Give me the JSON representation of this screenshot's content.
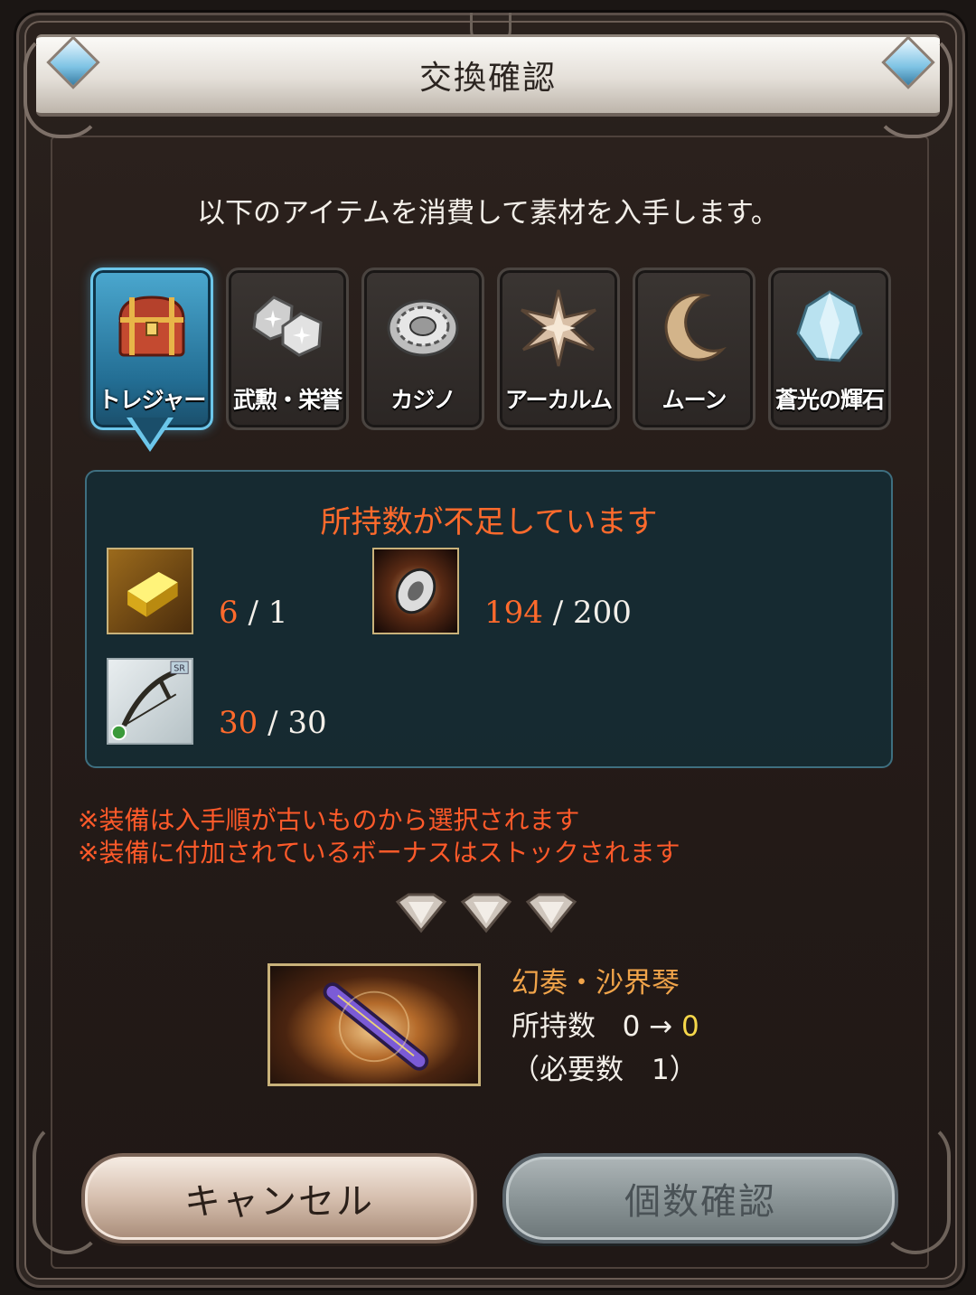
{
  "dialog": {
    "title": "交換確認",
    "subtitle": "以下のアイテムを消費して素材を入手します。"
  },
  "tabs": [
    {
      "label": "トレジャー",
      "icon": "treasure-chest-icon",
      "selected": true
    },
    {
      "label": "武勲・栄誉",
      "icon": "honor-badges-icon",
      "selected": false
    },
    {
      "label": "カジノ",
      "icon": "casino-chip-icon",
      "selected": false
    },
    {
      "label": "アーカルム",
      "icon": "arcarum-star-icon",
      "selected": false
    },
    {
      "label": "ムーン",
      "icon": "moon-icon",
      "selected": false
    },
    {
      "label": "蒼光の輝石",
      "icon": "crystal-icon",
      "selected": false
    }
  ],
  "materials": {
    "warning": "所持数が不足しています",
    "items": [
      {
        "icon": "gold-brick-icon",
        "have": "6",
        "sep": "/",
        "need": "1"
      },
      {
        "icon": "silver-centrum-icon",
        "have": "194",
        "sep": "/",
        "need": "200"
      },
      {
        "icon": "bow-weapon-icon",
        "badge": "SR",
        "have": "30",
        "sep": "/",
        "need": "30"
      }
    ]
  },
  "notes": [
    "※装備は入手順が古いものから選択されます",
    "※装備に付加されているボーナスはストックされます"
  ],
  "result": {
    "name": "幻奏・沙界琴",
    "have_label": "所持数",
    "have_before": "0",
    "arrow": "→",
    "have_after": "0",
    "need_text": "（必要数　1）"
  },
  "buttons": {
    "cancel": "キャンセル",
    "confirm": "個数確認"
  },
  "colors": {
    "warning": "#ff6a2c",
    "selected_tab": "#3a94bd",
    "item_name": "#f1a44a"
  }
}
